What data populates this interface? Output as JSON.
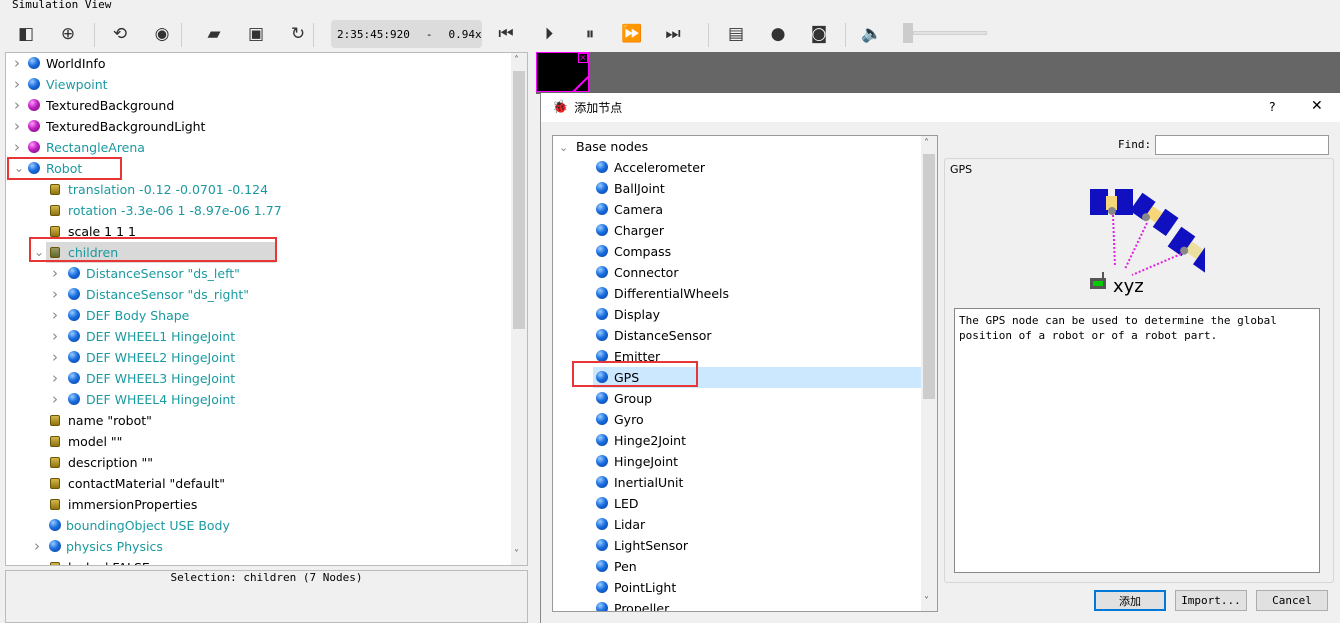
{
  "window": {
    "title": "Simulation View"
  },
  "toolbar": {
    "icons": [
      "toggle-panel-icon",
      "add-icon",
      "rotate-view-icon",
      "eye-icon",
      "open-folder-icon",
      "save-icon",
      "reload-icon",
      "step-back-icon",
      "step-icon",
      "pause-icon",
      "fast-forward-icon",
      "fastest-icon",
      "movie-icon",
      "record-icon",
      "camera-icon",
      "mute-icon"
    ],
    "time": "2:35:45:920",
    "dash": "-",
    "speed": "0.94x",
    "volume": 0
  },
  "tree": {
    "items": [
      {
        "label": "WorldInfo",
        "icon": "node-blue",
        "teal": false,
        "level": 0,
        "arrow": ">"
      },
      {
        "label": "Viewpoint",
        "icon": "node-blue",
        "teal": true,
        "level": 0,
        "arrow": ">"
      },
      {
        "label": "TexturedBackground",
        "icon": "node-purple",
        "teal": false,
        "level": 0,
        "arrow": ">"
      },
      {
        "label": "TexturedBackgroundLight",
        "icon": "node-purple",
        "teal": false,
        "level": 0,
        "arrow": ">"
      },
      {
        "label": "RectangleArena",
        "icon": "node-purple",
        "teal": true,
        "level": 0,
        "arrow": ">"
      },
      {
        "label": "Robot",
        "icon": "node-blue",
        "teal": true,
        "level": 0,
        "arrow": "v"
      },
      {
        "label": "translation -0.12 -0.0701 -0.124",
        "icon": "field",
        "teal": true,
        "level": 1
      },
      {
        "label": "rotation -3.3e-06 1 -8.97e-06 1.77",
        "icon": "field",
        "teal": true,
        "level": 1
      },
      {
        "label": "scale 1 1 1",
        "icon": "field",
        "teal": false,
        "level": 1
      },
      {
        "label": "children",
        "icon": "field",
        "teal": true,
        "level": 1,
        "arrow": "v",
        "selected": true
      },
      {
        "label": "DistanceSensor \"ds_left\"",
        "icon": "node-blue",
        "teal": true,
        "level": 2,
        "arrow": ">"
      },
      {
        "label": "DistanceSensor \"ds_right\"",
        "icon": "node-blue",
        "teal": true,
        "level": 2,
        "arrow": ">"
      },
      {
        "label": "DEF Body Shape",
        "icon": "node-blue",
        "teal": true,
        "level": 2,
        "arrow": ">"
      },
      {
        "label": "DEF WHEEL1 HingeJoint",
        "icon": "node-blue",
        "teal": true,
        "level": 2,
        "arrow": ">"
      },
      {
        "label": "DEF WHEEL2 HingeJoint",
        "icon": "node-blue",
        "teal": true,
        "level": 2,
        "arrow": ">"
      },
      {
        "label": "DEF WHEEL3 HingeJoint",
        "icon": "node-blue",
        "teal": true,
        "level": 2,
        "arrow": ">"
      },
      {
        "label": "DEF WHEEL4 HingeJoint",
        "icon": "node-blue",
        "teal": true,
        "level": 2,
        "arrow": ">"
      },
      {
        "label": "name \"robot\"",
        "icon": "field",
        "teal": false,
        "level": 1
      },
      {
        "label": "model \"\"",
        "icon": "field",
        "teal": false,
        "level": 1
      },
      {
        "label": "description \"\"",
        "icon": "field",
        "teal": false,
        "level": 1
      },
      {
        "label": "contactMaterial \"default\"",
        "icon": "field",
        "teal": false,
        "level": 1
      },
      {
        "label": "immersionProperties",
        "icon": "field",
        "teal": false,
        "level": 1
      },
      {
        "label": "boundingObject USE Body",
        "icon": "node-blue",
        "teal": true,
        "level": 3
      },
      {
        "label": "physics Physics",
        "icon": "node-blue",
        "teal": true,
        "level": 3,
        "arrow": ">"
      },
      {
        "label": "locked FALSE",
        "icon": "field",
        "teal": false,
        "level": 1
      }
    ]
  },
  "status": {
    "selection": "Selection: children (7 Nodes)"
  },
  "dialog": {
    "title": "添加节点",
    "help": "?",
    "close": "✕",
    "group": "Base nodes",
    "nodes": [
      "Accelerometer",
      "BallJoint",
      "Camera",
      "Charger",
      "Compass",
      "Connector",
      "DifferentialWheels",
      "Display",
      "DistanceSensor",
      "Emitter",
      "GPS",
      "Group",
      "Gyro",
      "Hinge2Joint",
      "HingeJoint",
      "InertialUnit",
      "LED",
      "Lidar",
      "LightSensor",
      "Pen",
      "PointLight",
      "Propeller"
    ],
    "selected": "GPS",
    "find_label": "Find:",
    "find_value": "",
    "info_title": "GPS",
    "image_caption": "xyz",
    "description": "The GPS node can be used to determine the global position of a robot or of a robot part.",
    "add_label": "添加",
    "import_label": "Import...",
    "cancel_label": "Cancel"
  },
  "colors": {
    "teal": "#1a9aa0",
    "highlight": "#cce8ff",
    "annotation": "#e83535"
  }
}
